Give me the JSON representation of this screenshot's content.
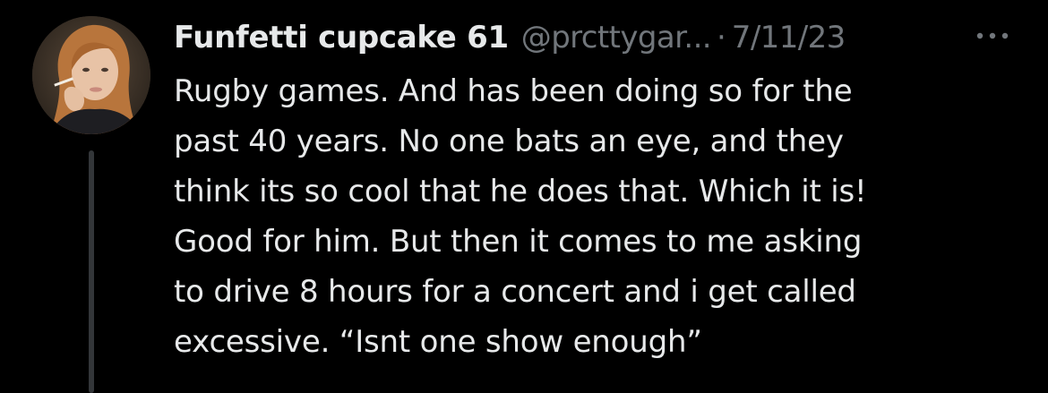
{
  "tweet": {
    "display_name": "Funfetti cupcake 61",
    "handle": "@prcttygar...",
    "separator": "·",
    "timestamp": "7/11/23",
    "more_icon": "more-horizontal-icon",
    "text_lines": [
      "Rugby games. And has been doing so for the",
      "past 40 years. No one bats an eye, and they",
      "think its so cool that he does that. Which it is!",
      "Good for him. But then it comes to me asking",
      "to drive 8 hours for a concert and i get called",
      "excessive. “Isnt one show enough”"
    ]
  },
  "colors": {
    "background": "#000000",
    "primary_text": "#e7e9ea",
    "secondary_text": "#71767b",
    "thread_line": "#333639"
  }
}
